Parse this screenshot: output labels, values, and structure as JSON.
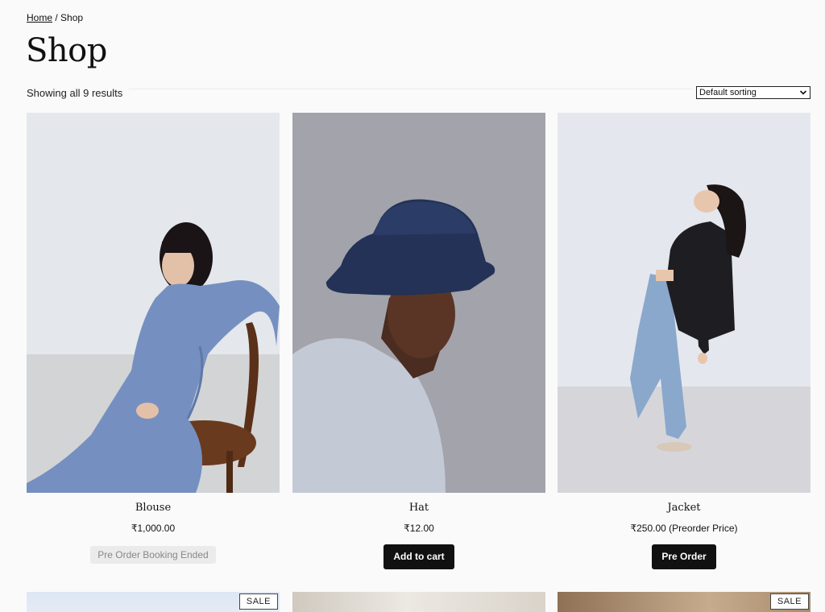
{
  "breadcrumb": {
    "home": "Home",
    "separator": " / ",
    "current": "Shop"
  },
  "page": {
    "title": "Shop",
    "result_count": "Showing all 9 results"
  },
  "sort": {
    "selected": "Default sorting"
  },
  "products": [
    {
      "name": "Blouse",
      "price": "₹1,000.00",
      "action": "Pre Order Booking Ended"
    },
    {
      "name": "Hat",
      "price": "₹12.00",
      "action": "Add to cart"
    },
    {
      "name": "Jacket",
      "price": "₹250.00 (Preorder Price)",
      "action": "Pre Order"
    }
  ],
  "row2": [
    {
      "badge": "SALE"
    },
    {
      "badge": ""
    },
    {
      "badge": "SALE"
    }
  ],
  "colors": {
    "button_dark": "#111111",
    "button_disabled": "#ebebeb",
    "background": "#fafafa"
  }
}
